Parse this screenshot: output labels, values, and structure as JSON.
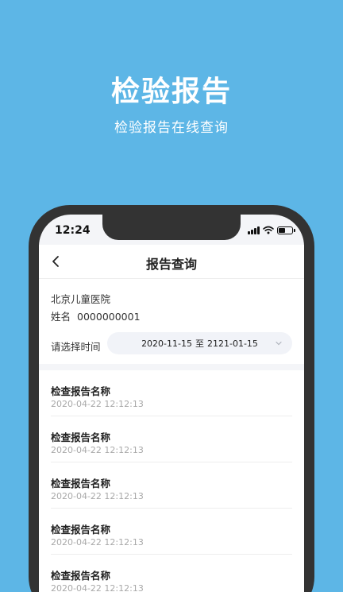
{
  "promo": {
    "title": "检验报告",
    "subtitle": "检验报告在线查询"
  },
  "status_bar": {
    "time": "12:24"
  },
  "navbar": {
    "title": "报告查询"
  },
  "patient": {
    "hospital": "北京儿童医院",
    "name_label": "姓名",
    "id": "0000000001"
  },
  "date_filter": {
    "label": "请选择时间",
    "start": "2020-11-15",
    "separator": "至",
    "end": "2121-01-15"
  },
  "reports": [
    {
      "name": "检查报告名称",
      "date": "2020-04-22 12:12:13"
    },
    {
      "name": "检查报告名称",
      "date": "2020-04-22 12:12:13"
    },
    {
      "name": "检查报告名称",
      "date": "2020-04-22 12:12:13"
    },
    {
      "name": "检查报告名称",
      "date": "2020-04-22 12:12:13"
    },
    {
      "name": "检查报告名称",
      "date": "2020-04-22 12:12:13"
    }
  ],
  "colors": {
    "background": "#5db6e6",
    "phone_frame": "#333333",
    "secondary_text": "#a8a8a8"
  }
}
